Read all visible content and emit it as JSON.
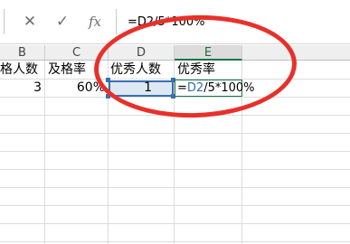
{
  "formula_bar": {
    "cancel_icon": "cancel-x-icon",
    "enter_icon": "checkmark-icon",
    "fx_label": "fx",
    "formula": "=D2/5*100%"
  },
  "columns": [
    {
      "label": "B",
      "active": false
    },
    {
      "label": "C",
      "active": false
    },
    {
      "label": "D",
      "active": false
    },
    {
      "label": "E",
      "active": true
    }
  ],
  "rows": {
    "row1": {
      "B": "格人数",
      "C": "及格率",
      "D": "优秀人数",
      "E": "优秀率"
    },
    "row2": {
      "B": "3",
      "C": "60%",
      "D": "1",
      "E_prefix": "=",
      "E_ref": "D2",
      "E_suffix": "/5*100%"
    }
  },
  "colors": {
    "annotation": "#e8302a",
    "selection": "#3a6fb0",
    "active_cell": "#217346",
    "reference_text": "#2e6db5"
  }
}
